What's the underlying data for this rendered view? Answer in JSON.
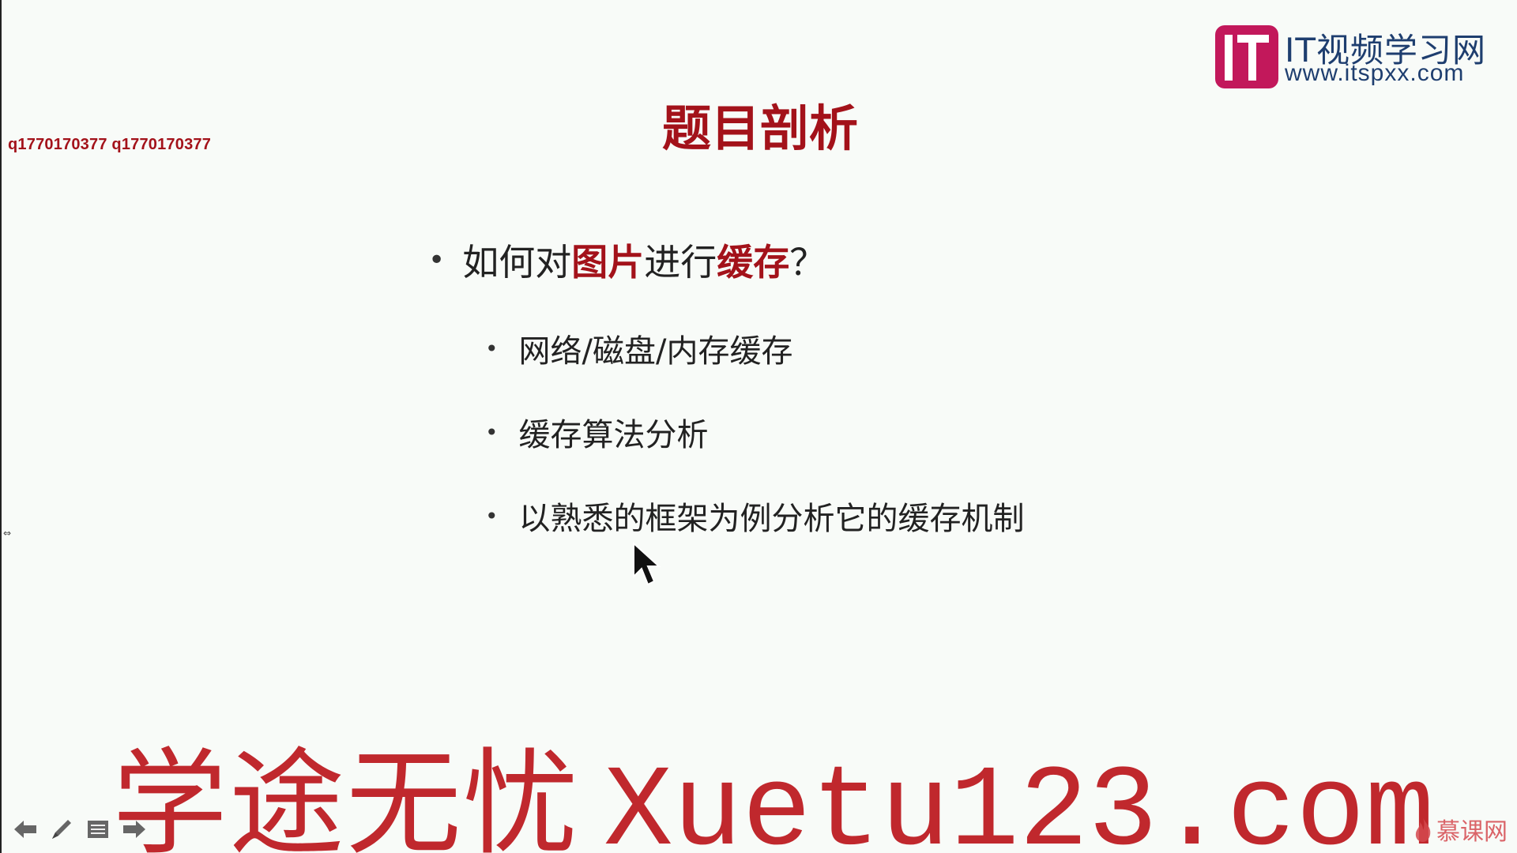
{
  "corner_text": "q1770170377 q1770170377",
  "logo": {
    "title": "IT视频学习网",
    "url": "www.itspxx.com"
  },
  "slide": {
    "title": "题目剖析",
    "main_bullet": {
      "prefix": "如何对",
      "highlight1": "图片",
      "middle": "进行",
      "highlight2": "缓存",
      "suffix": "？"
    },
    "sub_bullets": [
      "网络/磁盘/内存缓存",
      "缓存算法分析",
      "以熟悉的框架为例分析它的缓存机制"
    ]
  },
  "watermark": {
    "cjk": "学途无忧",
    "latin": "Xuetu123.com"
  },
  "brand_bottom": "慕课网",
  "colors": {
    "accent_red": "#a3121a",
    "watermark_red": "#c0282d",
    "logo_magenta": "#c2185b",
    "logo_navy": "#1e3e6f"
  },
  "icons": {
    "prev": "arrow-left-icon",
    "pen": "pen-icon",
    "menu": "slide-menu-icon",
    "next": "arrow-right-icon",
    "cursor": "mouse-pointer-icon",
    "flame": "flame-icon"
  }
}
